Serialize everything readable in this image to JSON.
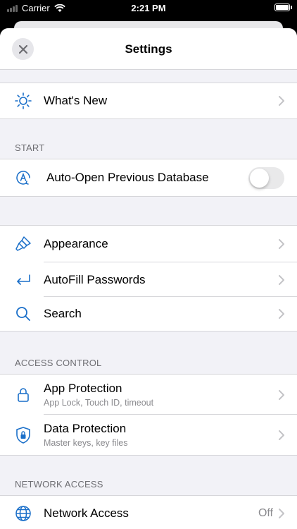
{
  "status_bar": {
    "carrier": "Carrier",
    "time": "2:21 PM",
    "icons": [
      "signal-icon",
      "wifi-icon",
      "battery-icon"
    ]
  },
  "header": {
    "title": "Settings",
    "close_icon": "close-icon"
  },
  "groups": {
    "whats_new": {
      "label": "What's New",
      "icon": "sun-icon"
    },
    "start": {
      "header": "START",
      "auto_open": {
        "label": "Auto-Open Previous Database",
        "icon": "auto-open-icon",
        "toggle_on": false
      }
    },
    "general": {
      "appearance": {
        "label": "Appearance",
        "icon": "paintbrush-icon"
      },
      "autofill": {
        "label": "AutoFill Passwords",
        "icon": "autofill-icon"
      },
      "search": {
        "label": "Search",
        "icon": "search-icon"
      }
    },
    "access_control": {
      "header": "ACCESS CONTROL",
      "app_protection": {
        "label": "App Protection",
        "sub": "App Lock, Touch ID, timeout",
        "icon": "lock-icon"
      },
      "data_protection": {
        "label": "Data Protection",
        "sub": "Master keys, key files",
        "icon": "shield-lock-icon"
      }
    },
    "network_access": {
      "header": "NETWORK ACCESS",
      "network": {
        "label": "Network Access",
        "value": "Off",
        "icon": "globe-icon"
      }
    }
  },
  "colors": {
    "accent": "#1a6fc9",
    "background": "#f2f2f7",
    "separator": "#d6d6da"
  }
}
